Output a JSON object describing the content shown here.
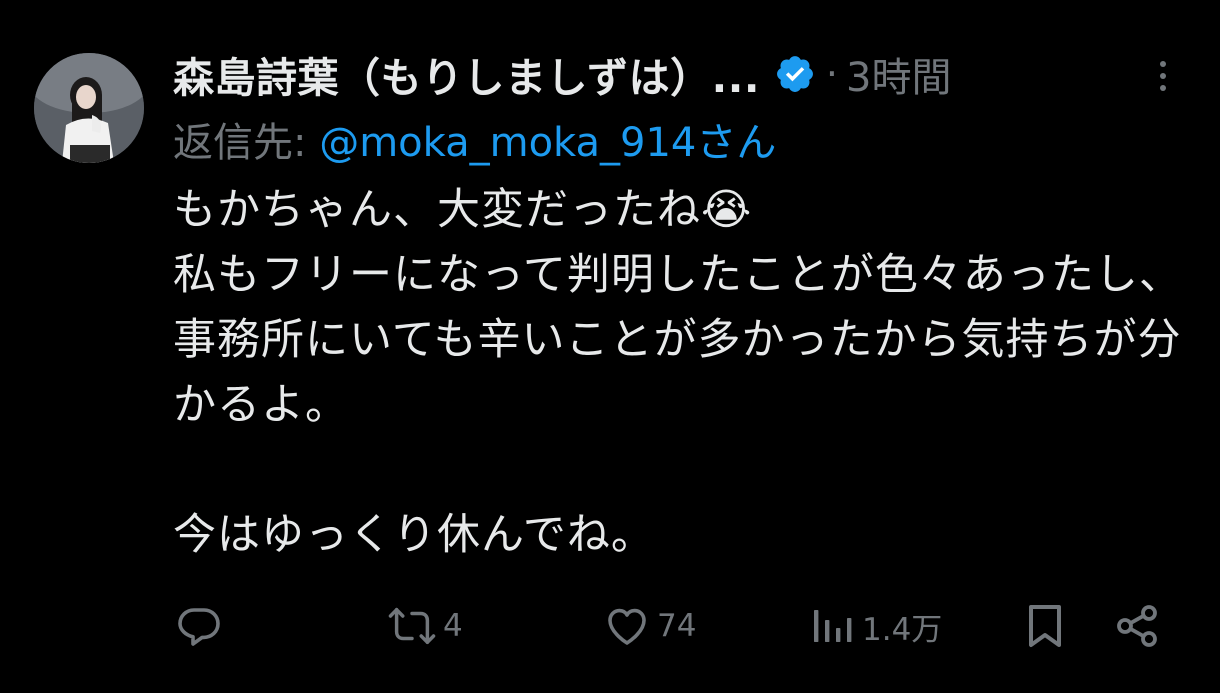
{
  "tweet": {
    "author": {
      "display_name": "森島詩葉（もりしましずは）...",
      "verified": true
    },
    "separator": "·",
    "timestamp": "3時間",
    "reply": {
      "prefix": "返信先: ",
      "handle": "@moka_moka_914さん"
    },
    "text": "もかちゃん、大変だったね😭\n私もフリーになって判明したことが色々あったし、事務所にいても辛いことが多かったから気持ちが分かるよ。\n\n今はゆっくり休んでね。",
    "actions": {
      "reply": {
        "icon": "reply-icon",
        "count": ""
      },
      "retweet": {
        "icon": "retweet-icon",
        "count": "4"
      },
      "like": {
        "icon": "heart-icon",
        "count": "74"
      },
      "views": {
        "icon": "views-icon",
        "count": "1.4万"
      },
      "bookmark": {
        "icon": "bookmark-icon"
      },
      "share": {
        "icon": "share-icon"
      }
    }
  },
  "colors": {
    "background": "#000000",
    "primary_text": "#e7e9ea",
    "secondary_text": "#71767b",
    "accent": "#1d9bf0"
  }
}
